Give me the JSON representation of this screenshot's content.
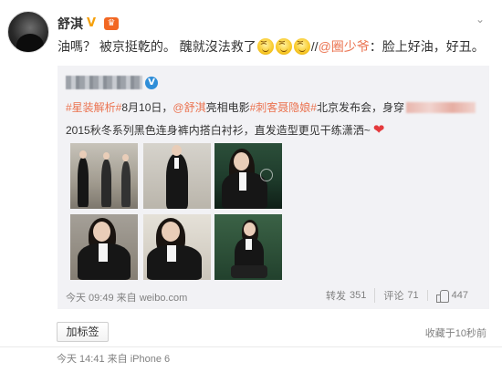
{
  "post": {
    "username": "舒淇",
    "text_main": "油嗎？ 被京挺乾的。 醜就沒法救了",
    "text_separator": "//",
    "reply_mention": "@圈少爷",
    "reply_text": "：脸上好油，好丑。",
    "meta": "今天 14:41 来自 iPhone 6",
    "tag_button_label": "加标签",
    "collect_time": "收藏于10秒前"
  },
  "repost": {
    "line1": {
      "hashtag1": "#星装解析#",
      "date": "8月10日，",
      "mention": "@舒淇",
      "text1": " 亮相电影",
      "hashtag2": "#刺客聂隐娘#",
      "text2": "北京发布会，身穿"
    },
    "line2": "2015秋冬系列黑色连身裤内搭白衬衫，直发造型更见干练潇洒~",
    "meta": "今天 09:49 来自 weibo.com",
    "actions": {
      "repost_label": "转发",
      "repost_count": "351",
      "comment_label": "评论",
      "comment_count": "71",
      "like_count": "447"
    }
  },
  "colors": {
    "link": "#eb7350",
    "repost_bg": "#f2f2f5",
    "meta_text": "#808080",
    "verified": "#2f8ed8"
  },
  "icons": [
    "avatar",
    "vip-icon",
    "member-icon",
    "dropdown-icon",
    "verified-icon",
    "heart-icon",
    "thumbs-up-icon",
    "emoji-icon"
  ]
}
